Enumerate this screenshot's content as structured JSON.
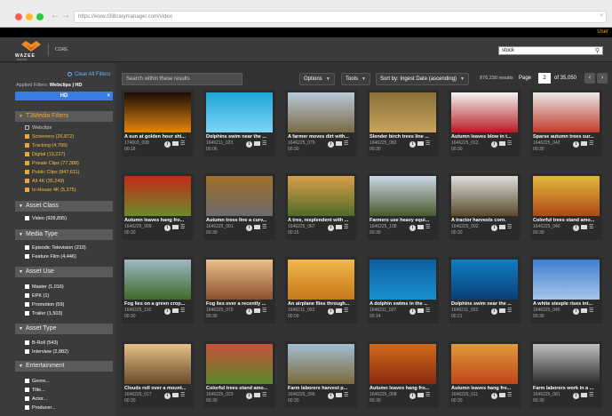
{
  "browser": {
    "url": "https://www.t3librarymanager.com/video"
  },
  "header": {
    "user_label": "User",
    "logo_text": "WAZEE",
    "logo_sub": "DIGITAL",
    "app_label": "CORE",
    "search_value": "stock"
  },
  "sidebar": {
    "clear_all": "Clear All Filters",
    "applied_label": "Applied Filters:",
    "applied_value": "Webclips | HD",
    "chip": "HD",
    "sections": [
      {
        "title": "T3Media Filters",
        "items": [
          {
            "label": "Webclips",
            "style": "check"
          },
          {
            "label": "Screeners (26,872)",
            "style": "orange"
          },
          {
            "label": "Tracking (4,799)",
            "style": "orange"
          },
          {
            "label": "Digital (19,227)",
            "style": "orange"
          },
          {
            "label": "Private Clips (77,388)",
            "style": "orange"
          },
          {
            "label": "Public Clips (847,611)",
            "style": "orange"
          },
          {
            "label": "All 4K (35,249)",
            "style": "orange"
          },
          {
            "label": "In-House 4K (5,375)",
            "style": "orange"
          }
        ]
      },
      {
        "title": "Asset Class",
        "items": [
          {
            "label": "Video (928,895)",
            "style": "white"
          }
        ]
      },
      {
        "title": "Media Type",
        "items": [
          {
            "label": "Episodic Television (210)",
            "style": "white"
          },
          {
            "label": "Feature Film (4,446)",
            "style": "white"
          }
        ]
      },
      {
        "title": "Asset Use",
        "items": [
          {
            "label": "Master (1,016)",
            "style": "white"
          },
          {
            "label": "EPK (1)",
            "style": "white"
          },
          {
            "label": "Promotion (59)",
            "style": "white"
          },
          {
            "label": "Trailer (1,503)",
            "style": "white"
          }
        ]
      },
      {
        "title": "Asset Type",
        "items": [
          {
            "label": "B-Roll (543)",
            "style": "white"
          },
          {
            "label": "Interview (2,882)",
            "style": "white"
          }
        ]
      },
      {
        "title": "Entertainment",
        "items": [
          {
            "label": "Genre...",
            "style": "white"
          },
          {
            "label": "Title...",
            "style": "white"
          },
          {
            "label": "Actor...",
            "style": "white"
          },
          {
            "label": "Producer...",
            "style": "white"
          }
        ]
      }
    ]
  },
  "toolbar": {
    "search_placeholder": "Search within these results",
    "options": "Options",
    "tools": "Tools",
    "sort": "Sort by: Ingest Date (ascending)",
    "results": "876,230 results",
    "page_label": "Page",
    "page_value": "2",
    "page_of": "of 35,050"
  },
  "cards": [
    {
      "title": "A sun at golden hour shi...",
      "id": "174003_008",
      "dur": "00:18",
      "c1": "#1b0c04",
      "c2": "#e3860e"
    },
    {
      "title": "Dolphins swim near the ...",
      "id": "1646211_023",
      "dur": "00:06",
      "c1": "#1fa5d9",
      "c2": "#7fd4f4"
    },
    {
      "title": "A farmer moves dirt with...",
      "id": "1646225_079",
      "dur": "00:30",
      "c1": "#b7c9d8",
      "c2": "#7c6a44"
    },
    {
      "title": "Slender birch trees line ...",
      "id": "1646225_082",
      "dur": "00:30",
      "c1": "#8b6e38",
      "c2": "#c8a55c"
    },
    {
      "title": "Autumn leaves blow in t...",
      "id": "1646225_012",
      "dur": "00:30",
      "c1": "#f3f3f3",
      "c2": "#b81c24"
    },
    {
      "title": "Sparse autumn trees sur...",
      "id": "1646225_042",
      "dur": "00:30",
      "c1": "#e7e7e7",
      "c2": "#c43a2a"
    },
    {
      "title": "Autumn leaves hang fro...",
      "id": "1646225_009",
      "dur": "00:30",
      "c1": "#c02a16",
      "c2": "#6e8a2a"
    },
    {
      "title": "Autumn trees line a curv...",
      "id": "1646225_001",
      "dur": "00:30",
      "c1": "#a07028",
      "c2": "#6b6b6b"
    },
    {
      "title": "A tree, resplendent with ...",
      "id": "1646225_067",
      "dur": "00:15",
      "c1": "#d8a04a",
      "c2": "#4f6b2a"
    },
    {
      "title": "Farmers use heavy equi...",
      "id": "1646225_108",
      "dur": "00:30",
      "c1": "#c9d8e6",
      "c2": "#4a5a2c"
    },
    {
      "title": "A tractor harvests corn.",
      "id": "1646225_092",
      "dur": "00:30",
      "c1": "#dddddd",
      "c2": "#5a4a2a"
    },
    {
      "title": "Colorful trees stand amo...",
      "id": "1646225_040",
      "dur": "00:30",
      "c1": "#e2b93a",
      "c2": "#b04818"
    },
    {
      "title": "Fog lies on a green crop...",
      "id": "1646225_116",
      "dur": "00:30",
      "c1": "#9fb7c5",
      "c2": "#3f6a2a"
    },
    {
      "title": "Fog lies over a recently ...",
      "id": "1646225_070",
      "dur": "00:30",
      "c1": "#e9c08a",
      "c2": "#8a5030"
    },
    {
      "title": "An airplane flies through...",
      "id": "1646211_003",
      "dur": "00:09",
      "c1": "#f0b84a",
      "c2": "#c7781c"
    },
    {
      "title": "A dolphin swims in the ...",
      "id": "1646211_027",
      "dur": "00:14",
      "c1": "#0b5f9e",
      "c2": "#1c8fd0"
    },
    {
      "title": "Dolphins swim near the ...",
      "id": "1646211_022",
      "dur": "00:21",
      "c1": "#0f7fc2",
      "c2": "#0a3f78"
    },
    {
      "title": "A white steeple rises int...",
      "id": "1646225_045",
      "dur": "00:30",
      "c1": "#3f7fcf",
      "c2": "#a7c6ea"
    },
    {
      "title": "Clouds roll over a mount...",
      "id": "1646225_017",
      "dur": "00:30",
      "c1": "#e6c08a",
      "c2": "#6a4a2a"
    },
    {
      "title": "Colorful trees stand amo...",
      "id": "1646225_023",
      "dur": "00:30",
      "c1": "#c8503a",
      "c2": "#5a8a2a"
    },
    {
      "title": "Farm laborers harvest p...",
      "id": "1646225_096",
      "dur": "00:30",
      "c1": "#a3bcd0",
      "c2": "#7a6a3a"
    },
    {
      "title": "Autumn leaves hang fro...",
      "id": "1646225_008",
      "dur": "00:30",
      "c1": "#d26a1a",
      "c2": "#8a2a10"
    },
    {
      "title": "Autumn leaves hang fro...",
      "id": "1646225_011",
      "dur": "00:30",
      "c1": "#e09a3a",
      "c2": "#c04418"
    },
    {
      "title": "Farm laborers work in a ...",
      "id": "1646225_081",
      "dur": "00:30",
      "c1": "#c0c0c0",
      "c2": "#2a2a2a"
    }
  ]
}
